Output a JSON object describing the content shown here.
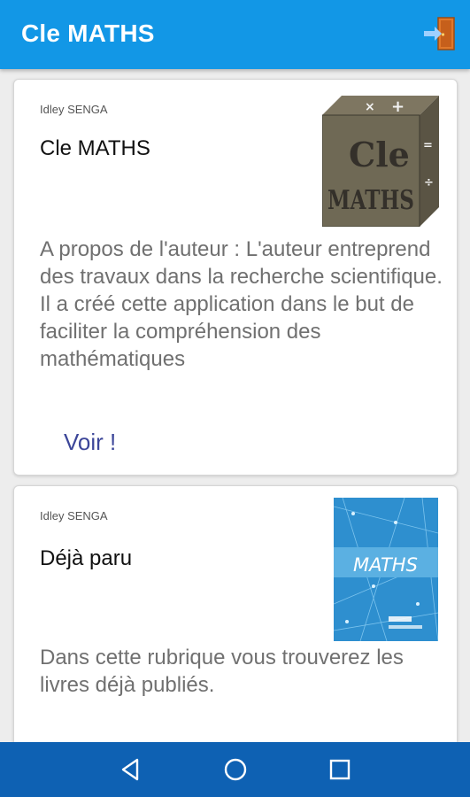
{
  "app_bar": {
    "title": "Cle MATHS",
    "exit_icon": "exit-door-icon",
    "color": "#1297e6"
  },
  "cards": [
    {
      "author": "Idley SENGA",
      "title": "Cle MATHS",
      "description": "A propos de l'auteur : L'auteur entreprend des travaux dans la recherche scientifique. Il a créé cette application dans le but de faciliter la compréhension des mathématiques",
      "action_label": "Voir !",
      "cover_text_line1": "Cle",
      "cover_text_line2": "MATHS"
    },
    {
      "author": "Idley SENGA",
      "title": "Déjà paru",
      "description": "Dans cette rubrique vous trouverez les livres déjà publiés.",
      "cover_title": "MATHS"
    }
  ],
  "nav_bar": {
    "icons": [
      "back-icon",
      "home-icon",
      "recents-icon"
    ],
    "color": "#0e61b3"
  }
}
